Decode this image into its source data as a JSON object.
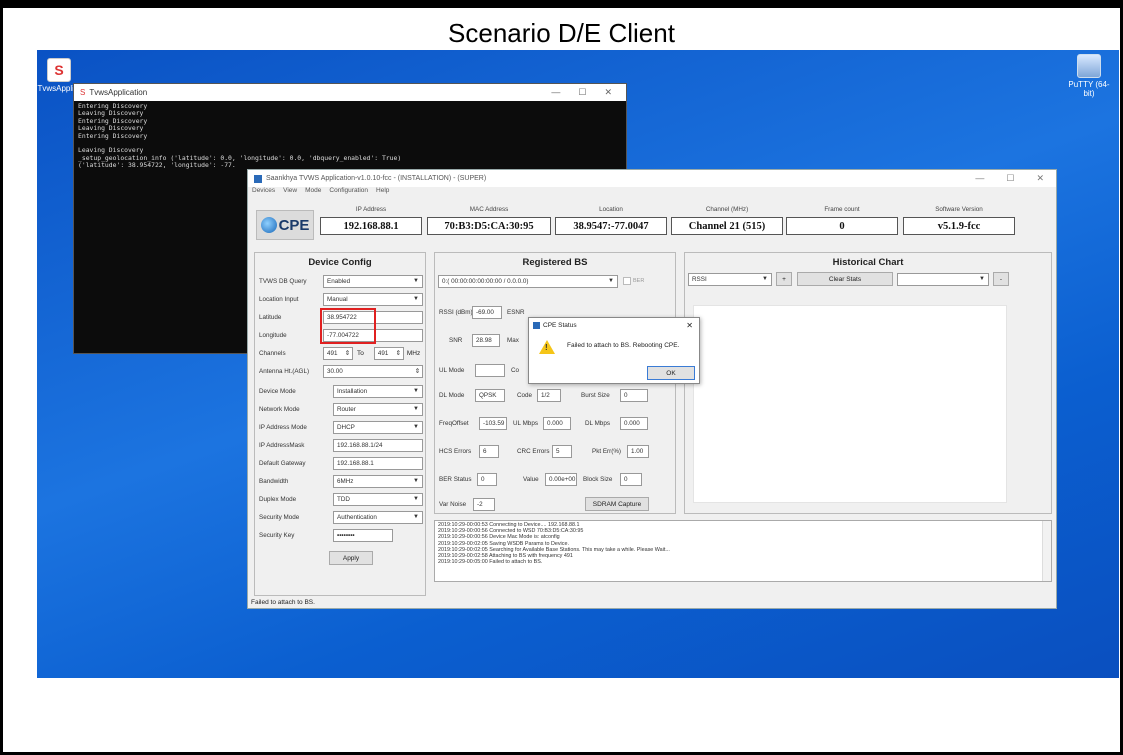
{
  "slide": {
    "title": "Scenario D/E Client"
  },
  "desktop": {
    "icons": [
      {
        "label": "TvwsAppli..."
      },
      {
        "label": "PuTTY (64-bit)"
      }
    ]
  },
  "console": {
    "title": "TvwsApplication",
    "lines": [
      "Entering Discovery",
      "Leaving Discovery",
      "Entering Discovery",
      "Leaving Discovery",
      "Entering Discovery",
      "",
      "Leaving Discovery",
      "_setup_geolocation_info ('latitude': 0.0, 'longitude': 0.0, 'dbquery_enabled': True)",
      "('latitude': 38.954722, 'longitude': -77."
    ]
  },
  "app": {
    "title": "Saankhya TVWS Application-v1.0.10-fcc - (INSTALLATION) - (SUPER)",
    "menu": [
      "Devices",
      "View",
      "Mode",
      "Configuration",
      "Help"
    ],
    "logo_text": "CPE",
    "header": [
      {
        "label": "IP Address",
        "value": "192.168.88.1"
      },
      {
        "label": "MAC Address",
        "value": "70:B3:D5:CA:30:95"
      },
      {
        "label": "Location",
        "value": "38.9547:-77.0047"
      },
      {
        "label": "Channel (MHz)",
        "value": "Channel 21 (515)"
      },
      {
        "label": "Frame count",
        "value": "0"
      },
      {
        "label": "Software Version",
        "value": "v5.1.9-fcc"
      }
    ],
    "device_config": {
      "title": "Device Config",
      "tvws_db_query": {
        "label": "TVWS DB Query",
        "value": "Enabled"
      },
      "location_input": {
        "label": "Location Input",
        "value": "Manual"
      },
      "latitude": {
        "label": "Latitude",
        "value": "38.954722"
      },
      "longitude": {
        "label": "Longitude",
        "value": "-77.004722"
      },
      "channels": {
        "label": "Channels",
        "from": "491",
        "to_label": "To",
        "to": "491",
        "unit": "MHz"
      },
      "antenna": {
        "label": "Antenna Ht.(AGL)",
        "value": "30.00"
      },
      "device_mode": {
        "label": "Device Mode",
        "value": "Installation"
      },
      "network_mode": {
        "label": "Network Mode",
        "value": "Router"
      },
      "ip_mode": {
        "label": "IP Address Mode",
        "value": "DHCP"
      },
      "ip_mask": {
        "label": "IP AddressMask",
        "value": "192.168.88.1/24"
      },
      "gateway": {
        "label": "Default Gateway",
        "value": "192.168.88.1"
      },
      "bandwidth": {
        "label": "Bandwidth",
        "value": "6MHz"
      },
      "duplex": {
        "label": "Duplex Mode",
        "value": "TDD"
      },
      "security_mode": {
        "label": "Security Mode",
        "value": "Authentication"
      },
      "security_key": {
        "label": "Security Key",
        "value": "••••••••"
      },
      "apply": "Apply"
    },
    "registered_bs": {
      "title": "Registered BS",
      "select": "0:( 00:00:00:00:00:00 / 0.0.0.0)",
      "ber_label": "BER",
      "rssi_label": "RSSI (dBm)",
      "rssi": "-69.00",
      "esnr_label": "ESNR",
      "snr_label": "SNR",
      "snr": "28.98",
      "max_label": "Max",
      "ul_mode_label": "UL Mode",
      "ul_mode": "",
      "co_label": "Co",
      "dl_mode_label": "DL Mode",
      "dl_mode": "QPSK",
      "code_label": "Code",
      "code": "1/2",
      "burst_label": "Burst Size",
      "burst": "0",
      "freq_label": "FreqOffset",
      "freq": "-103.59",
      "ulmbps_label": "UL Mbps",
      "ulmbps": "0.000",
      "dlmbps_label": "DL Mbps",
      "dlmbps": "0.000",
      "hcs_label": "HCS Errors",
      "hcs": "6",
      "crc_label": "CRC Errors",
      "crc": "5",
      "pkt_label": "Pkt Err(%)",
      "pkt": "1.00",
      "berstat_label": "BER Status",
      "berstat": "0",
      "value_label": "Value",
      "value": "0.00e+00",
      "block_label": "Block Size",
      "block": "0",
      "varnoise_label": "Var Noise",
      "varnoise": "-2",
      "sdram": "SDRAM Capture"
    },
    "historical": {
      "title": "Historical Chart",
      "select": "RSSI",
      "plus": "+",
      "clear": "Clear Stats",
      "minus": "-"
    },
    "log_lines": [
      "2019:10:29-00:00:53 Connecting to Device.... 192.168.88.1",
      "2019:10:29-00:00:56 Connected to WSD 70:B3:D5:CA:30:95",
      "2019:10:29-00:00:56 Device Mac Mode is: atconfig",
      "2019:10:29-00:02:05 Saving WSDB Params to Device.",
      "2019:10:29-00:02:05 Searching for Available Base Stations. This may take a while. Please Wait...",
      "2019:10:29-00:02:58 Attaching to BS with frequency 491",
      "2019:10:29-00:05:00 Failed to attach to BS."
    ],
    "status": "Failed to attach to BS.",
    "dialog": {
      "title": "CPE Status",
      "message": "Failed to attach to BS. Rebooting CPE.",
      "ok": "OK"
    }
  }
}
